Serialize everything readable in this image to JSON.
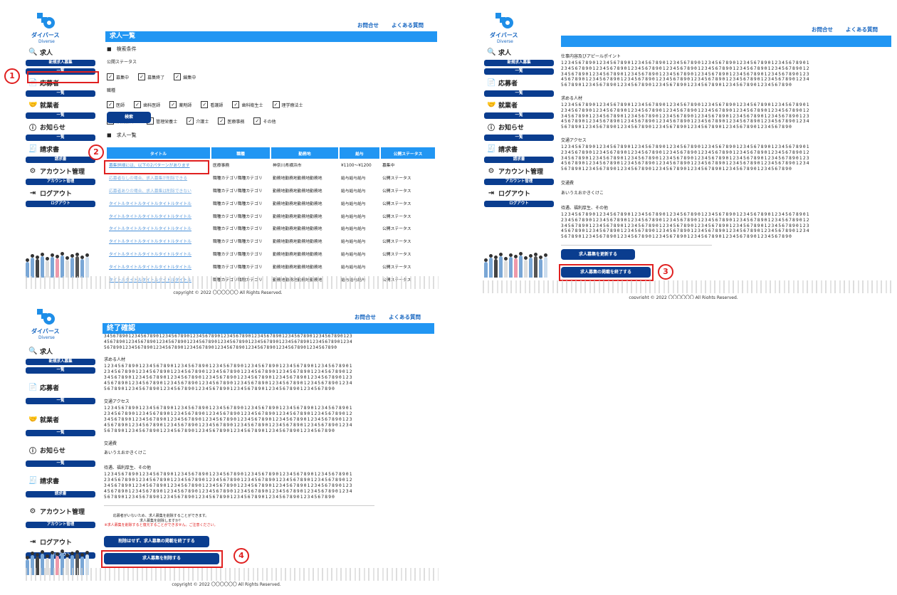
{
  "brand": {
    "logo_text": "ダイバース",
    "logo_sub": "Diverse"
  },
  "topnav": {
    "contact": "お問合せ",
    "faq": "よくある質問"
  },
  "sidebar": {
    "jobs": "求人",
    "new_job": "新規求人募集",
    "list": "一覧",
    "applicants": "応募者",
    "employees": "就業者",
    "notices": "お知らせ",
    "invoices": "請求書",
    "invoice_btn": "請求書",
    "account": "アカウント管理",
    "account_btn": "アカウント管理",
    "logout": "ログアウト",
    "logout_btn": "ログアウト"
  },
  "copyright": "copyright © 2022 〇〇〇〇〇〇 All Rights Reserved.",
  "panel1": {
    "title": "求人一覧",
    "search_heading": "■　検索条件",
    "status_label": "公開ステータス",
    "statuses": [
      "募集中",
      "募集終了",
      "編集中"
    ],
    "occupation_label": "職種",
    "occupations_row1": [
      "医師",
      "歯科医師",
      "薬剤師",
      "看護師",
      "歯科衛生士",
      "理学療法士"
    ],
    "occupations_row2": [
      "作業療法士",
      "管理栄養士",
      "介護士",
      "医療事務",
      "その他"
    ],
    "search_button": "検索",
    "list_heading": "■　求人一覧",
    "columns": [
      "タイトル",
      "職種",
      "勤務地",
      "給与",
      "公開ステータス"
    ],
    "rows": [
      [
        "募集詳細には、以下の2パターンがあります",
        "医療事務",
        "神奈川県横浜市",
        "¥1100～¥1200",
        "募集中"
      ],
      [
        "応募者なしの場合、求人募集が削除できる",
        "職種カテゴリ職種カテゴリ",
        "勤務地勤務地勤務地勤務地",
        "給与給与給与",
        "公開ステータス"
      ],
      [
        "応募者ありの場合、求人募集は削除できない",
        "職種カテゴリ職種カテゴリ",
        "勤務地勤務地勤務地勤務地",
        "給与給与給与",
        "公開ステータス"
      ],
      [
        "タイトルタイトルタイトルタイトルタイトル",
        "職種カテゴリ職種カテゴリ",
        "勤務地勤務地勤務地勤務地",
        "給与給与給与",
        "公開ステータス"
      ],
      [
        "タイトルタイトルタイトルタイトルタイトル",
        "職種カテゴリ職種カテゴリ",
        "勤務地勤務地勤務地勤務地",
        "給与給与給与",
        "公開ステータス"
      ],
      [
        "タイトルタイトルタイトルタイトルタイトル",
        "職種カテゴリ職種カテゴリ",
        "勤務地勤務地勤務地勤務地",
        "給与給与給与",
        "公開ステータス"
      ],
      [
        "タイトルタイトルタイトルタイトルタイトル",
        "職種カテゴリ職種カテゴリ",
        "勤務地勤務地勤務地勤務地",
        "給与給与給与",
        "公開ステータス"
      ],
      [
        "タイトルタイトルタイトルタイトルタイトル",
        "職種カテゴリ職種カテゴリ",
        "勤務地勤務地勤務地勤務地",
        "給与給与給与",
        "公開ステータス"
      ],
      [
        "タイトルタイトルタイトルタイトルタイトル",
        "職種カテゴリ職種カテゴリ",
        "勤務地勤務地勤務地勤務地",
        "給与給与給与",
        "公開ステータス"
      ],
      [
        "タイトルタイトルタイトルタイトルタイトル",
        "職種カテゴリ職種カテゴリ",
        "勤務地勤務地勤務地勤務地",
        "給与給与給与",
        "公開ステータス"
      ]
    ]
  },
  "panel2": {
    "labels": [
      "仕事内容及びアピールポイント",
      "求める人材",
      "交通アクセス",
      "交通費",
      "待遇、福利厚生、その他"
    ],
    "block5": "12345678901234567890123456789012345678901234567890123456789012345678901\n23456789012345678901234567890123456789012345678901234567890123456789012\n34567890123456789012345678901234567890123456789012345678901234567890123\n45678901234567890123456789012345678901234567890123456789012345678901234\n567890123456789012345678901234567890123456789012345678901234567890",
    "block_access": "12345678901234567890123456789012345678901234567890123456789012345678901\n23456789012345678901234567890123456789012345678901234567890123456789012\n34567890123456789012345678901234567890123456789012345678901234567890123\n45678901234567890123456789012345678901234567890123456789012345678901234\n567890123456789012345678901234567890123456789012345678901234567890",
    "fare_value": "あいうえおかきくけこ",
    "update_button": "求人募集を更新する",
    "end_button": "求人募集の掲載を終了する"
  },
  "panel3": {
    "title": "終了確認",
    "top_block": "345678901234567890123456789012345678901234567890123456789012345678901234567890123\n456789012345678901234567890123456789012345678901234567890123456789012345678901234\n5678901234567890123456789012345678901234567890123456789012345678901234567890",
    "labels": [
      "求める人材",
      "交通アクセス",
      "交通費",
      "待遇、福利厚生、その他"
    ],
    "block": "12345678901234567890123456789012345678901234567890123456789012345678901\n23456789012345678901234567890123456789012345678901234567890123456789012\n34567890123456789012345678901234567890123456789012345678901234567890123\n45678901234567890123456789012345678901234567890123456789012345678901234\n567890123456789012345678901234567890123456789012345678901234567890",
    "fare_value": "あいうえおかきくけこ",
    "note1": "応募者がいないため、求人募集を削除することができます。",
    "note2": "求人募集を削除しますか？",
    "note3": "※求人募集を削除すると復元することができません。ご注意ください。",
    "keep_button": "削除はせず、求人募集の掲載を終了する",
    "delete_button": "求人募集を削除する"
  },
  "markers": [
    "1",
    "2",
    "3",
    "4"
  ],
  "colors": {
    "brand_blue": "#2196f3",
    "navy": "#0a3d8f",
    "marker_red": "#e02020"
  }
}
